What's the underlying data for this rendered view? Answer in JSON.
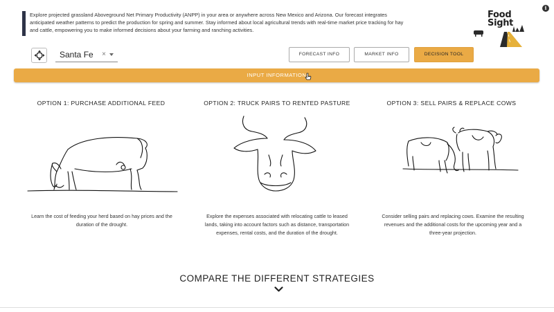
{
  "intro": {
    "text": "Explore projected grassland Aboveground Net Primary Productivity (ANPP) in your area or anywhere across New Mexico and Arizona. Our forecast integrates anticipated weather patterns to predict the production for spring and summer. Stay informed about local agricultural trends with real-time market price tracking for hay and cattle, empowering you to make informed decisions about your farming and ranching activities."
  },
  "logo": {
    "line1": "Food",
    "line2": "Sight"
  },
  "location": {
    "value": "Santa Fe",
    "clear": "×"
  },
  "nav": {
    "forecast": "FORECAST INFO",
    "market": "MARKET INFO",
    "decision": "DECISION TOOL"
  },
  "input_bar": {
    "label": "INPUT INFORMATION"
  },
  "options": [
    {
      "title": "OPTION 1: PURCHASE ADDITIONAL FEED",
      "desc": "Learn the cost of feeding your herd based on hay prices and the duration of the drought."
    },
    {
      "title": "OPTION 2: TRUCK PAIRS TO RENTED PASTURE",
      "desc": "Explore the expenses associated with relocating cattle to leased lands, taking into account factors such as distance, transportation expenses, rental costs, and the duration of the drought."
    },
    {
      "title": "OPTION 3: SELL PAIRS & REPLACE COWS",
      "desc": "Consider selling pairs and replacing cows. Examine the resulting revenues and the additional costs for the upcoming year and a three-year projection."
    }
  ],
  "compare": {
    "label": "COMPARE THE DIFFERENT STRATEGIES"
  },
  "icons": {
    "info": "info-icon",
    "locate": "crosshair-icon",
    "dropdown": "caret-down-icon",
    "compare": "chevron-down-icon"
  },
  "colors": {
    "accent": "#eaaa45",
    "intro_bar": "#2e3347"
  }
}
